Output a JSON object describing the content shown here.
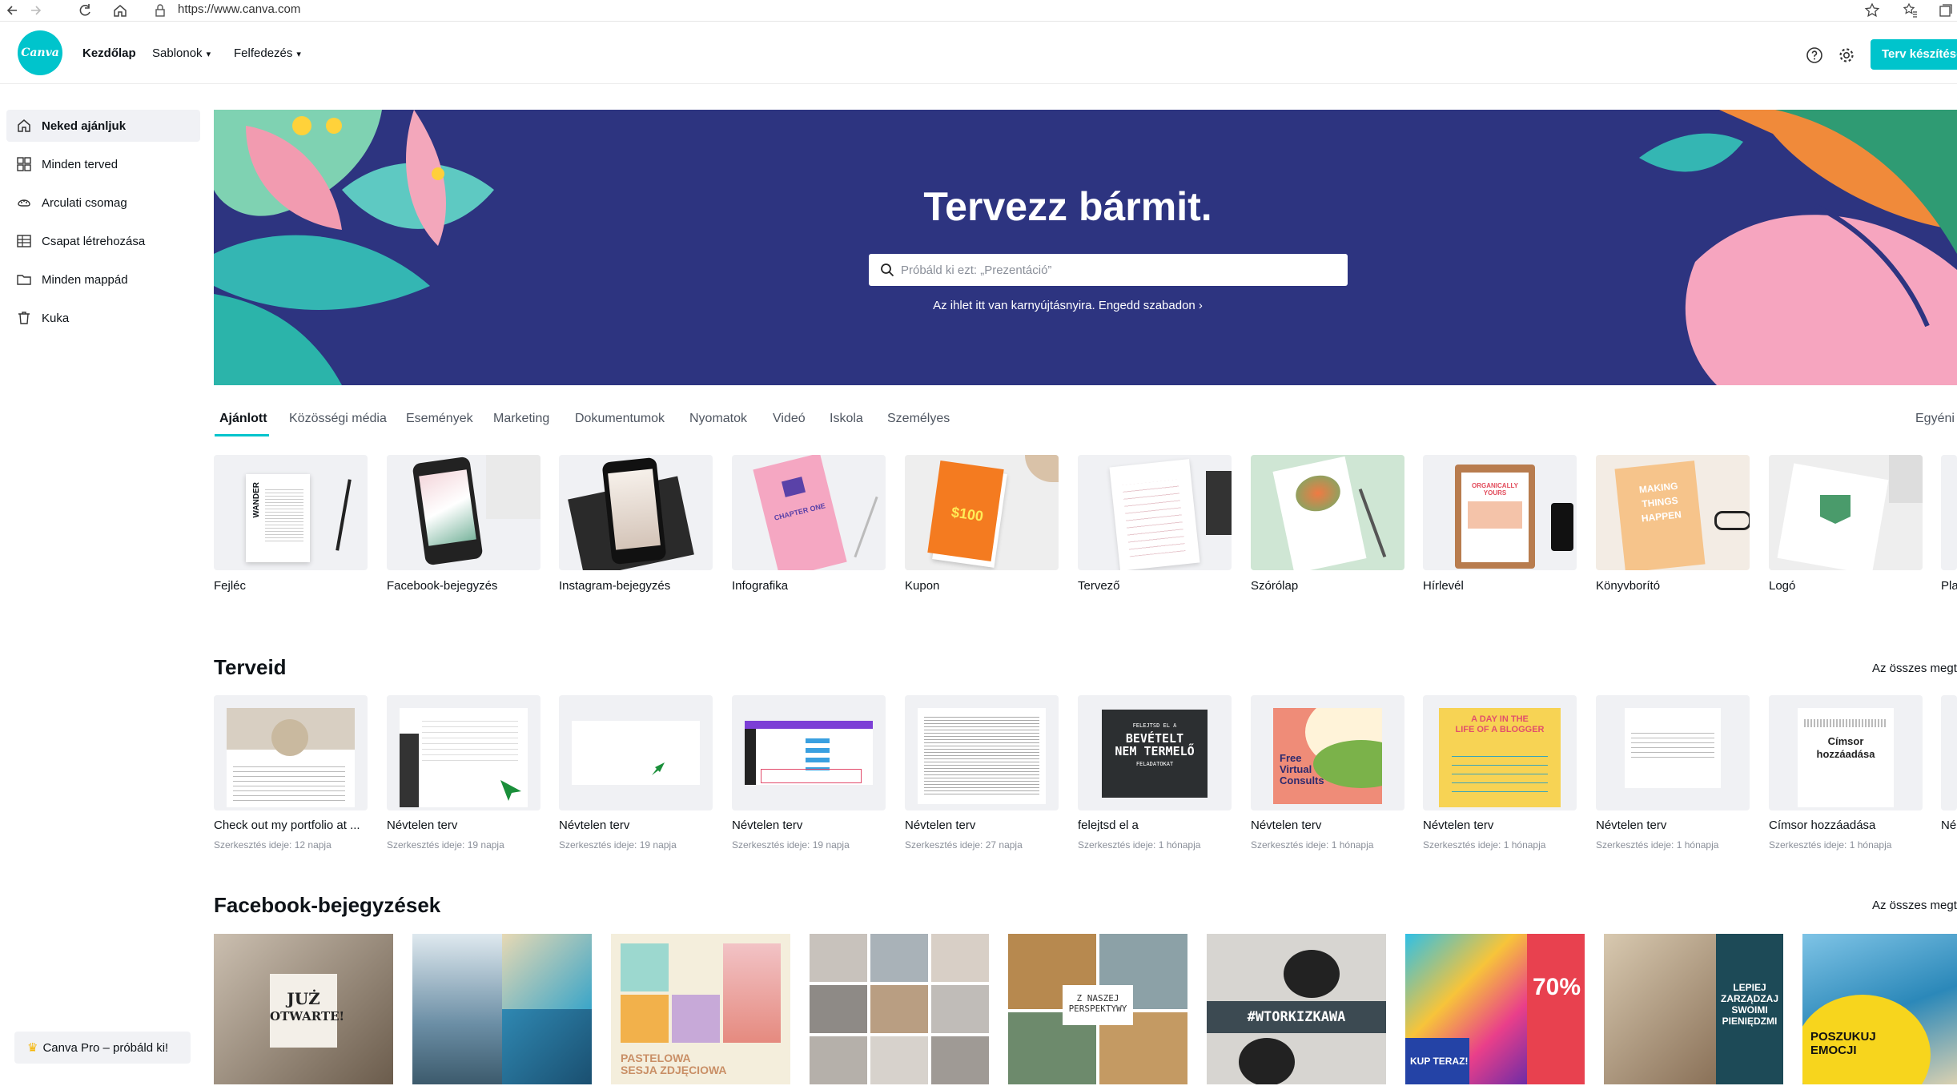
{
  "browser": {
    "url": "https://www.canva.com"
  },
  "nav": {
    "logo_text": "Canva",
    "links": [
      "Kezdőlap",
      "Sablonok",
      "Felfedezés"
    ],
    "create_button": "Terv készítése"
  },
  "sidebar": {
    "items": [
      {
        "label": "Neked ajánljuk",
        "icon": "home-icon"
      },
      {
        "label": "Minden terved",
        "icon": "grid-icon"
      },
      {
        "label": "Arculati csomag",
        "icon": "brand-kit-icon"
      },
      {
        "label": "Csapat létrehozása",
        "icon": "team-icon"
      },
      {
        "label": "Minden mappád",
        "icon": "folder-icon"
      },
      {
        "label": "Kuka",
        "icon": "trash-icon"
      }
    ],
    "pro_button": "Canva Pro – próbáld ki!"
  },
  "hero": {
    "title": "Tervezz bármit.",
    "search_placeholder": "Próbáld ki ezt: „Prezentáció”",
    "subtitle": "Az ihlet itt van karnyújtásnyira. Engedd szabadon ›"
  },
  "categories": {
    "tabs": [
      "Ajánlott",
      "Közösségi média",
      "Események",
      "Marketing",
      "Dokumentumok",
      "Nyomatok",
      "Videó",
      "Iskola",
      "Személyes"
    ],
    "right_link": "Egyéni"
  },
  "templates": [
    "Fejléc",
    "Facebook-bejegyzés",
    "Instagram-bejegyzés",
    "Infografika",
    "Kupon",
    "Tervező",
    "Szórólap",
    "Hírlevél",
    "Könyvborító",
    "Logó",
    "Pla"
  ],
  "designs": {
    "title": "Terveid",
    "see_all": "Az összes megt",
    "items": [
      {
        "name": "Check out my portfolio at ...",
        "edited": "Szerkesztés ideje: 12 napja"
      },
      {
        "name": "Névtelen terv",
        "edited": "Szerkesztés ideje: 19 napja"
      },
      {
        "name": "Névtelen terv",
        "edited": "Szerkesztés ideje: 19 napja"
      },
      {
        "name": "Névtelen terv",
        "edited": "Szerkesztés ideje: 19 napja"
      },
      {
        "name": "Névtelen terv",
        "edited": "Szerkesztés ideje: 27 napja"
      },
      {
        "name": "felejtsd el a",
        "edited": "Szerkesztés ideje: 1 hónapja"
      },
      {
        "name": "Névtelen terv",
        "edited": "Szerkesztés ideje: 1 hónapja"
      },
      {
        "name": "Névtelen terv",
        "edited": "Szerkesztés ideje: 1 hónapja"
      },
      {
        "name": "Névtelen terv",
        "edited": "Szerkesztés ideje: 1 hónapja"
      },
      {
        "name": "Címsor hozzáadása",
        "edited": "Szerkesztés ideje: 1 hónapja"
      },
      {
        "name": "Né",
        "edited": ""
      }
    ],
    "thumb_text": {
      "bevetelt": [
        "FELEJTSD EL A",
        "BEVÉTELT",
        "NEM TERMELŐ",
        "FELADATOKAT"
      ],
      "free": [
        "Free",
        "Virtual",
        "Consults"
      ],
      "blogger": [
        "A DAY IN THE",
        "LIFE OF A BLOGGER"
      ],
      "cimsor": [
        "Címsor",
        "hozzáadása"
      ]
    }
  },
  "facebook": {
    "title": "Facebook-bejegyzések",
    "see_all": "Az összes megt",
    "thumb_text": {
      "juz": [
        "JUŻ",
        "OTWARTE!"
      ],
      "sesja": [
        "PASTELOWA",
        "SESJA ZDJĘCIOWA"
      ],
      "perspektywy": [
        "Z NASZEJ",
        "PERSPEKTYWY"
      ],
      "kawa": "#WTORKIZKAWA",
      "kup": [
        "70%",
        "KUP TERAZ!"
      ],
      "lepiej": [
        "LEPIEJ",
        "ZARZĄDZAJ",
        "SWOIMI",
        "PIENIĘDZMI"
      ],
      "poszukuj": [
        "POSZUKUJ",
        "EMOCJI"
      ]
    }
  },
  "template_thumbs": {
    "wander": "WANDER",
    "chapter": "CHAPTER ONE",
    "coupon": "$100",
    "organically": "ORGANICALLY YOURS",
    "making": [
      "MAKING",
      "THINGS",
      "HAPPEN"
    ]
  },
  "colors": {
    "brand": "#00c4cc",
    "hero_bg": "#2d3480"
  }
}
